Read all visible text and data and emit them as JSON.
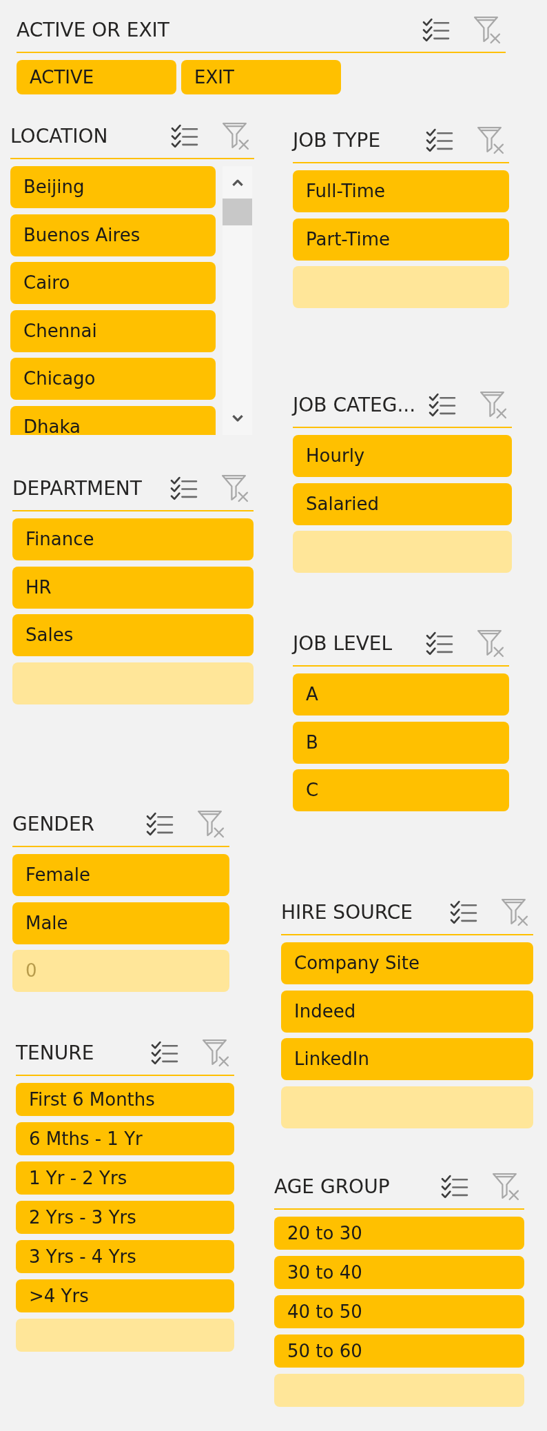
{
  "slicers": [
    {
      "title": "ACTIVE OR EXIT",
      "kind": "row",
      "items": [
        {
          "label": "ACTIVE",
          "selected": false,
          "disabled": false
        },
        {
          "label": "EXIT",
          "selected": false,
          "disabled": false
        }
      ]
    },
    {
      "title": "LOCATION",
      "kind": "list",
      "scrollbar": true,
      "items": [
        {
          "label": "Beijing",
          "selected": false,
          "disabled": false
        },
        {
          "label": "Buenos Aires",
          "selected": false,
          "disabled": false
        },
        {
          "label": "Cairo",
          "selected": false,
          "disabled": false
        },
        {
          "label": "Chennai",
          "selected": false,
          "disabled": false
        },
        {
          "label": "Chicago",
          "selected": false,
          "disabled": false
        },
        {
          "label": "Dhaka",
          "selected": false,
          "disabled": false
        }
      ]
    },
    {
      "title": "JOB TYPE",
      "kind": "list",
      "items": [
        {
          "label": "Full-Time",
          "selected": false,
          "disabled": false
        },
        {
          "label": "Part-Time",
          "selected": false,
          "disabled": false
        },
        {
          "selected": false,
          "disabled": true
        }
      ]
    },
    {
      "title": "JOB CATEG...",
      "kind": "list",
      "items": [
        {
          "label": "Hourly",
          "selected": false,
          "disabled": false
        },
        {
          "label": "Salaried",
          "selected": false,
          "disabled": false
        },
        {
          "selected": false,
          "disabled": true
        }
      ]
    },
    {
      "title": "DEPARTMENT",
      "kind": "list",
      "items": [
        {
          "label": "Finance",
          "selected": false,
          "disabled": false
        },
        {
          "label": "HR",
          "selected": false,
          "disabled": false
        },
        {
          "label": "Sales",
          "selected": false,
          "disabled": false
        },
        {
          "selected": false,
          "disabled": true
        }
      ]
    },
    {
      "title": "JOB LEVEL",
      "kind": "list",
      "items": [
        {
          "label": "A",
          "selected": false,
          "disabled": false
        },
        {
          "label": "B",
          "selected": false,
          "disabled": false
        },
        {
          "label": "C",
          "selected": false,
          "disabled": false
        }
      ]
    },
    {
      "title": "GENDER",
      "kind": "list",
      "items": [
        {
          "label": "Female",
          "selected": false,
          "disabled": false
        },
        {
          "label": "Male",
          "selected": false,
          "disabled": false
        },
        {
          "label": "0",
          "selected": false,
          "disabled": true
        }
      ]
    },
    {
      "title": "HIRE SOURCE",
      "kind": "list",
      "items": [
        {
          "label": "Company Site",
          "selected": false,
          "disabled": false
        },
        {
          "label": "Indeed",
          "selected": false,
          "disabled": false
        },
        {
          "label": "LinkedIn",
          "selected": false,
          "disabled": false
        },
        {
          "selected": false,
          "disabled": true
        }
      ]
    },
    {
      "title": "TENURE",
      "kind": "list",
      "items": [
        {
          "label": "First 6 Months",
          "selected": false,
          "disabled": false
        },
        {
          "label": "6 Mths - 1 Yr",
          "selected": false,
          "disabled": false
        },
        {
          "label": "1 Yr - 2 Yrs",
          "selected": false,
          "disabled": false
        },
        {
          "label": "2 Yrs - 3 Yrs",
          "selected": false,
          "disabled": false
        },
        {
          "label": "3 Yrs - 4 Yrs",
          "selected": false,
          "disabled": false
        },
        {
          "label": ">4 Yrs",
          "selected": false,
          "disabled": false
        },
        {
          "selected": false,
          "disabled": true
        }
      ]
    },
    {
      "title": "AGE GROUP",
      "kind": "list",
      "items": [
        {
          "label": "20 to 30",
          "selected": false,
          "disabled": false
        },
        {
          "label": "30 to 40",
          "selected": false,
          "disabled": false
        },
        {
          "label": "40 to 50",
          "selected": false,
          "disabled": false
        },
        {
          "label": "50 to 60",
          "selected": false,
          "disabled": false
        },
        {
          "selected": false,
          "disabled": true
        }
      ]
    }
  ]
}
